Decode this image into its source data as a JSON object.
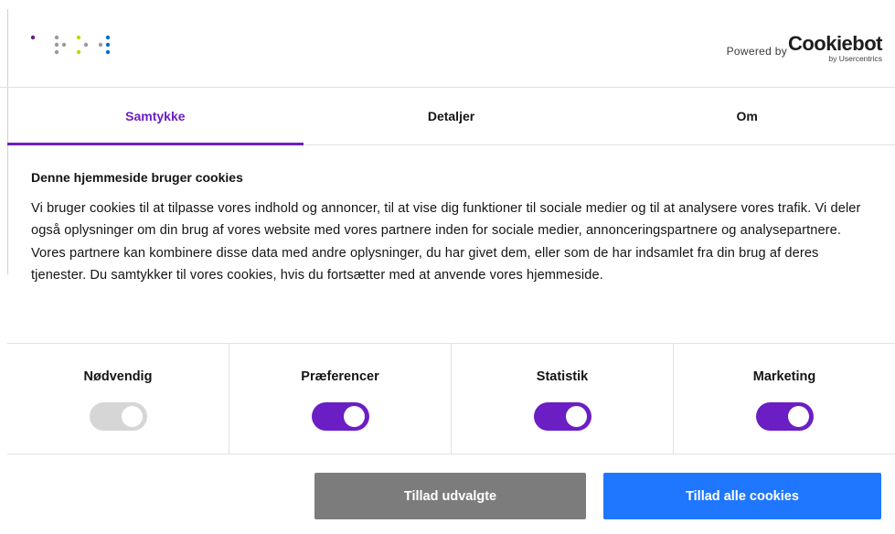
{
  "header": {
    "logo_icon": "dotted-brand-logo",
    "logo_colors": [
      "#6b1e83",
      "#9a9a9a",
      "#c8d400",
      "#0a6bd3"
    ],
    "powered_by_label": "Powered by",
    "cookiebot_word": "Cookiebot",
    "cookiebot_sub": "by Usercentrics"
  },
  "tabs": [
    {
      "label": "Samtykke",
      "active": true
    },
    {
      "label": "Detaljer",
      "active": false
    },
    {
      "label": "Om",
      "active": false
    }
  ],
  "consent": {
    "heading": "Denne hjemmeside bruger cookies",
    "paragraph": "Vi bruger cookies til at tilpasse vores indhold og annoncer, til at vise dig funktioner til sociale medier og til at analysere vores trafik. Vi deler også oplysninger om din brug af vores website med vores partnere inden for sociale medier, annonceringspartnere og analysepartnere. Vores partnere kan kombinere disse data med andre oplysninger, du har givet dem, eller som de har indsamlet fra din brug af deres tjenester. Du samtykker til vores cookies, hvis du fortsætter med at anvende vores hjemmeside."
  },
  "categories": [
    {
      "label": "Nødvendig",
      "enabled": true,
      "locked": true
    },
    {
      "label": "Præferencer",
      "enabled": true,
      "locked": false
    },
    {
      "label": "Statistik",
      "enabled": true,
      "locked": false
    },
    {
      "label": "Marketing",
      "enabled": true,
      "locked": false
    }
  ],
  "buttons": {
    "allow_selected": "Tillad udvalgte",
    "allow_all": "Tillad alle cookies"
  },
  "colors": {
    "accent": "#6b1ec4",
    "primary_button": "#1f77ff",
    "secondary_button": "#7c7c7c",
    "disabled_toggle": "#d6d6d6"
  }
}
